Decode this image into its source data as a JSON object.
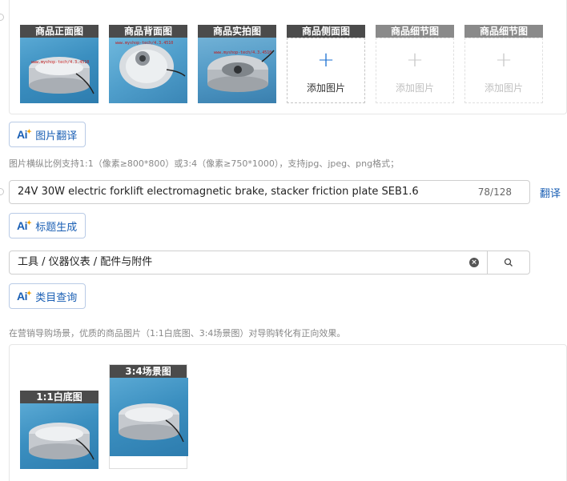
{
  "images": {
    "slots": [
      {
        "label": "商品正面图",
        "state": "filled",
        "watermark": "www.myshop-tech/4.3.4510"
      },
      {
        "label": "商品背面图",
        "state": "filled",
        "watermark": "www.myshop-tech/4.3.4510"
      },
      {
        "label": "商品实拍图",
        "state": "filled",
        "watermark": "www.myshop-tech/4.3.4510"
      },
      {
        "label": "商品侧面图",
        "state": "empty",
        "add_text": "添加图片"
      },
      {
        "label": "商品细节图",
        "state": "disabled",
        "add_text": "添加图片"
      },
      {
        "label": "商品细节图",
        "state": "disabled",
        "add_text": "添加图片"
      }
    ],
    "translate_button": "图片翻译",
    "hint": "图片横纵比例支持1:1（像素≥800*800）或3:4（像素≥750*1000），支持jpg、jpeg、png格式；"
  },
  "title": {
    "value": "24V 30W electric forklift electromagnetic brake, stacker friction plate SEB1.6",
    "count": "78/128",
    "translate_link": "翻译",
    "generate_button": "标题生成"
  },
  "category": {
    "value": "工具 / 仪器仪表 / 配件与附件",
    "query_button": "类目查询"
  },
  "marketing": {
    "hint": "在营销导购场景，优质的商品图片（1:1白底图、3:4场景图）对导购转化有正向效果。",
    "square_label": "1:1白底图",
    "scene_label": "3:4场景图"
  },
  "colors": {
    "accent": "#1a5fb4",
    "label_bg": "#4b4b4b",
    "photo_bg": "#4a9bcb"
  }
}
